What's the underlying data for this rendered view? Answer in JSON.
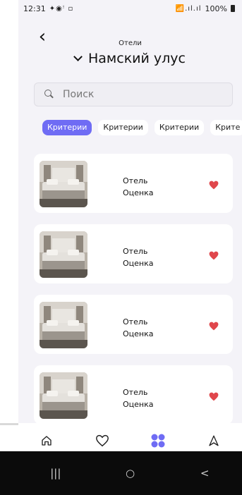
{
  "status_bar": {
    "time": "12:31",
    "left_icons": "✦◉ꜝ ▫",
    "right_icons": "📶.ıl.ıl",
    "battery": "100%"
  },
  "header": {
    "subtitle": "Отели",
    "title": "Намский улус"
  },
  "search": {
    "placeholder": "Поиск"
  },
  "chips": [
    {
      "label": "Критерии",
      "active": true
    },
    {
      "label": "Критерии",
      "active": false
    },
    {
      "label": "Критерии",
      "active": false
    },
    {
      "label": "Крите",
      "active": false
    }
  ],
  "hotels": [
    {
      "name": "Отель",
      "rating": "Оценка",
      "favorite": true
    },
    {
      "name": "Отель",
      "rating": "Оценка",
      "favorite": true
    },
    {
      "name": "Отель",
      "rating": "Оценка",
      "favorite": true
    },
    {
      "name": "Отель",
      "rating": "Оценка",
      "favorite": true
    }
  ],
  "bottom_nav": [
    {
      "icon": "home-icon"
    },
    {
      "icon": "heart-outline-icon"
    },
    {
      "icon": "grid-dots-icon",
      "active": true
    },
    {
      "icon": "navigation-arrow-icon"
    }
  ],
  "colors": {
    "accent": "#6f6cf4",
    "heart": "#e0474c",
    "background": "#f4f3f8"
  },
  "system_nav": {
    "recent": "|||",
    "home": "○",
    "back": "<"
  }
}
